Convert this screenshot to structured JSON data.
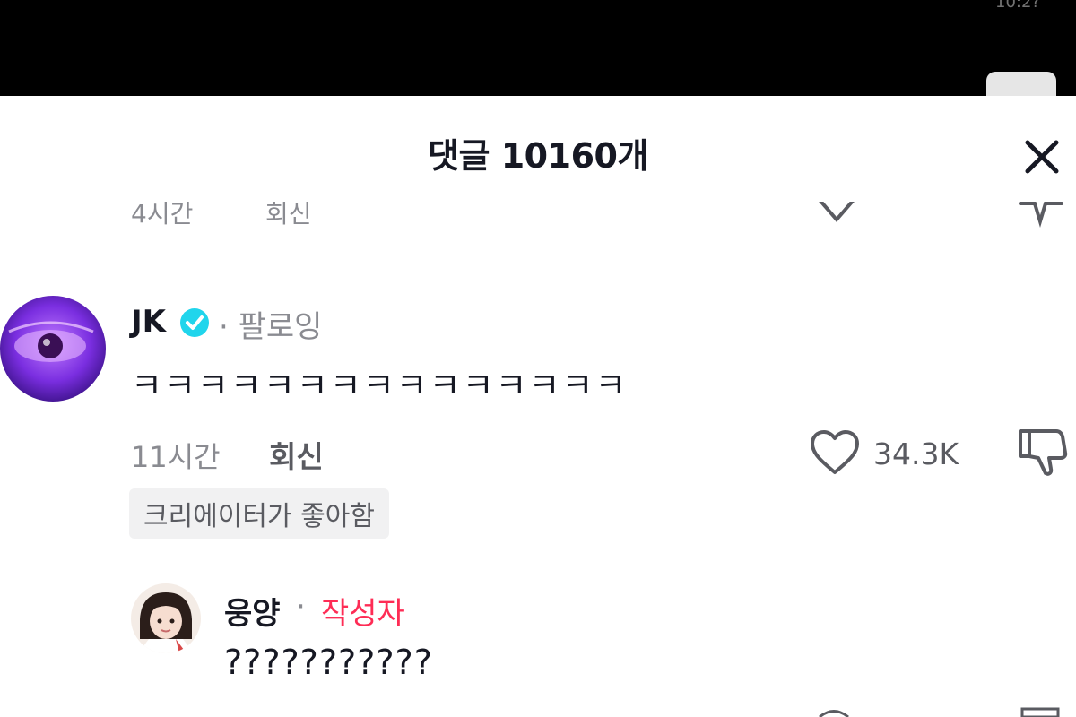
{
  "status_bar": {
    "corner_text": "10:2?"
  },
  "sheet": {
    "title": "댓글 10160개",
    "close_icon": "close-icon"
  },
  "previous_comment": {
    "time": "4시간",
    "reply_label": "회신"
  },
  "comment": {
    "username": "JK",
    "verified_icon": "verified-check-icon",
    "following_label": "· 팔로잉",
    "text": "ㅋㅋㅋㅋㅋㅋㅋㅋㅋㅋㅋㅋㅋㅋㅋ",
    "time": "11시간",
    "reply_label": "회신",
    "like_count": "34.3K",
    "creator_badge": "크리에이터가 좋아함"
  },
  "reply": {
    "username": "웅양",
    "separator": "·",
    "author_label": "작성자",
    "text": "???????????"
  },
  "colors": {
    "accent_red": "#fe2c55",
    "verified_blue": "#20d5ec",
    "muted_text": "#8a8b91"
  }
}
